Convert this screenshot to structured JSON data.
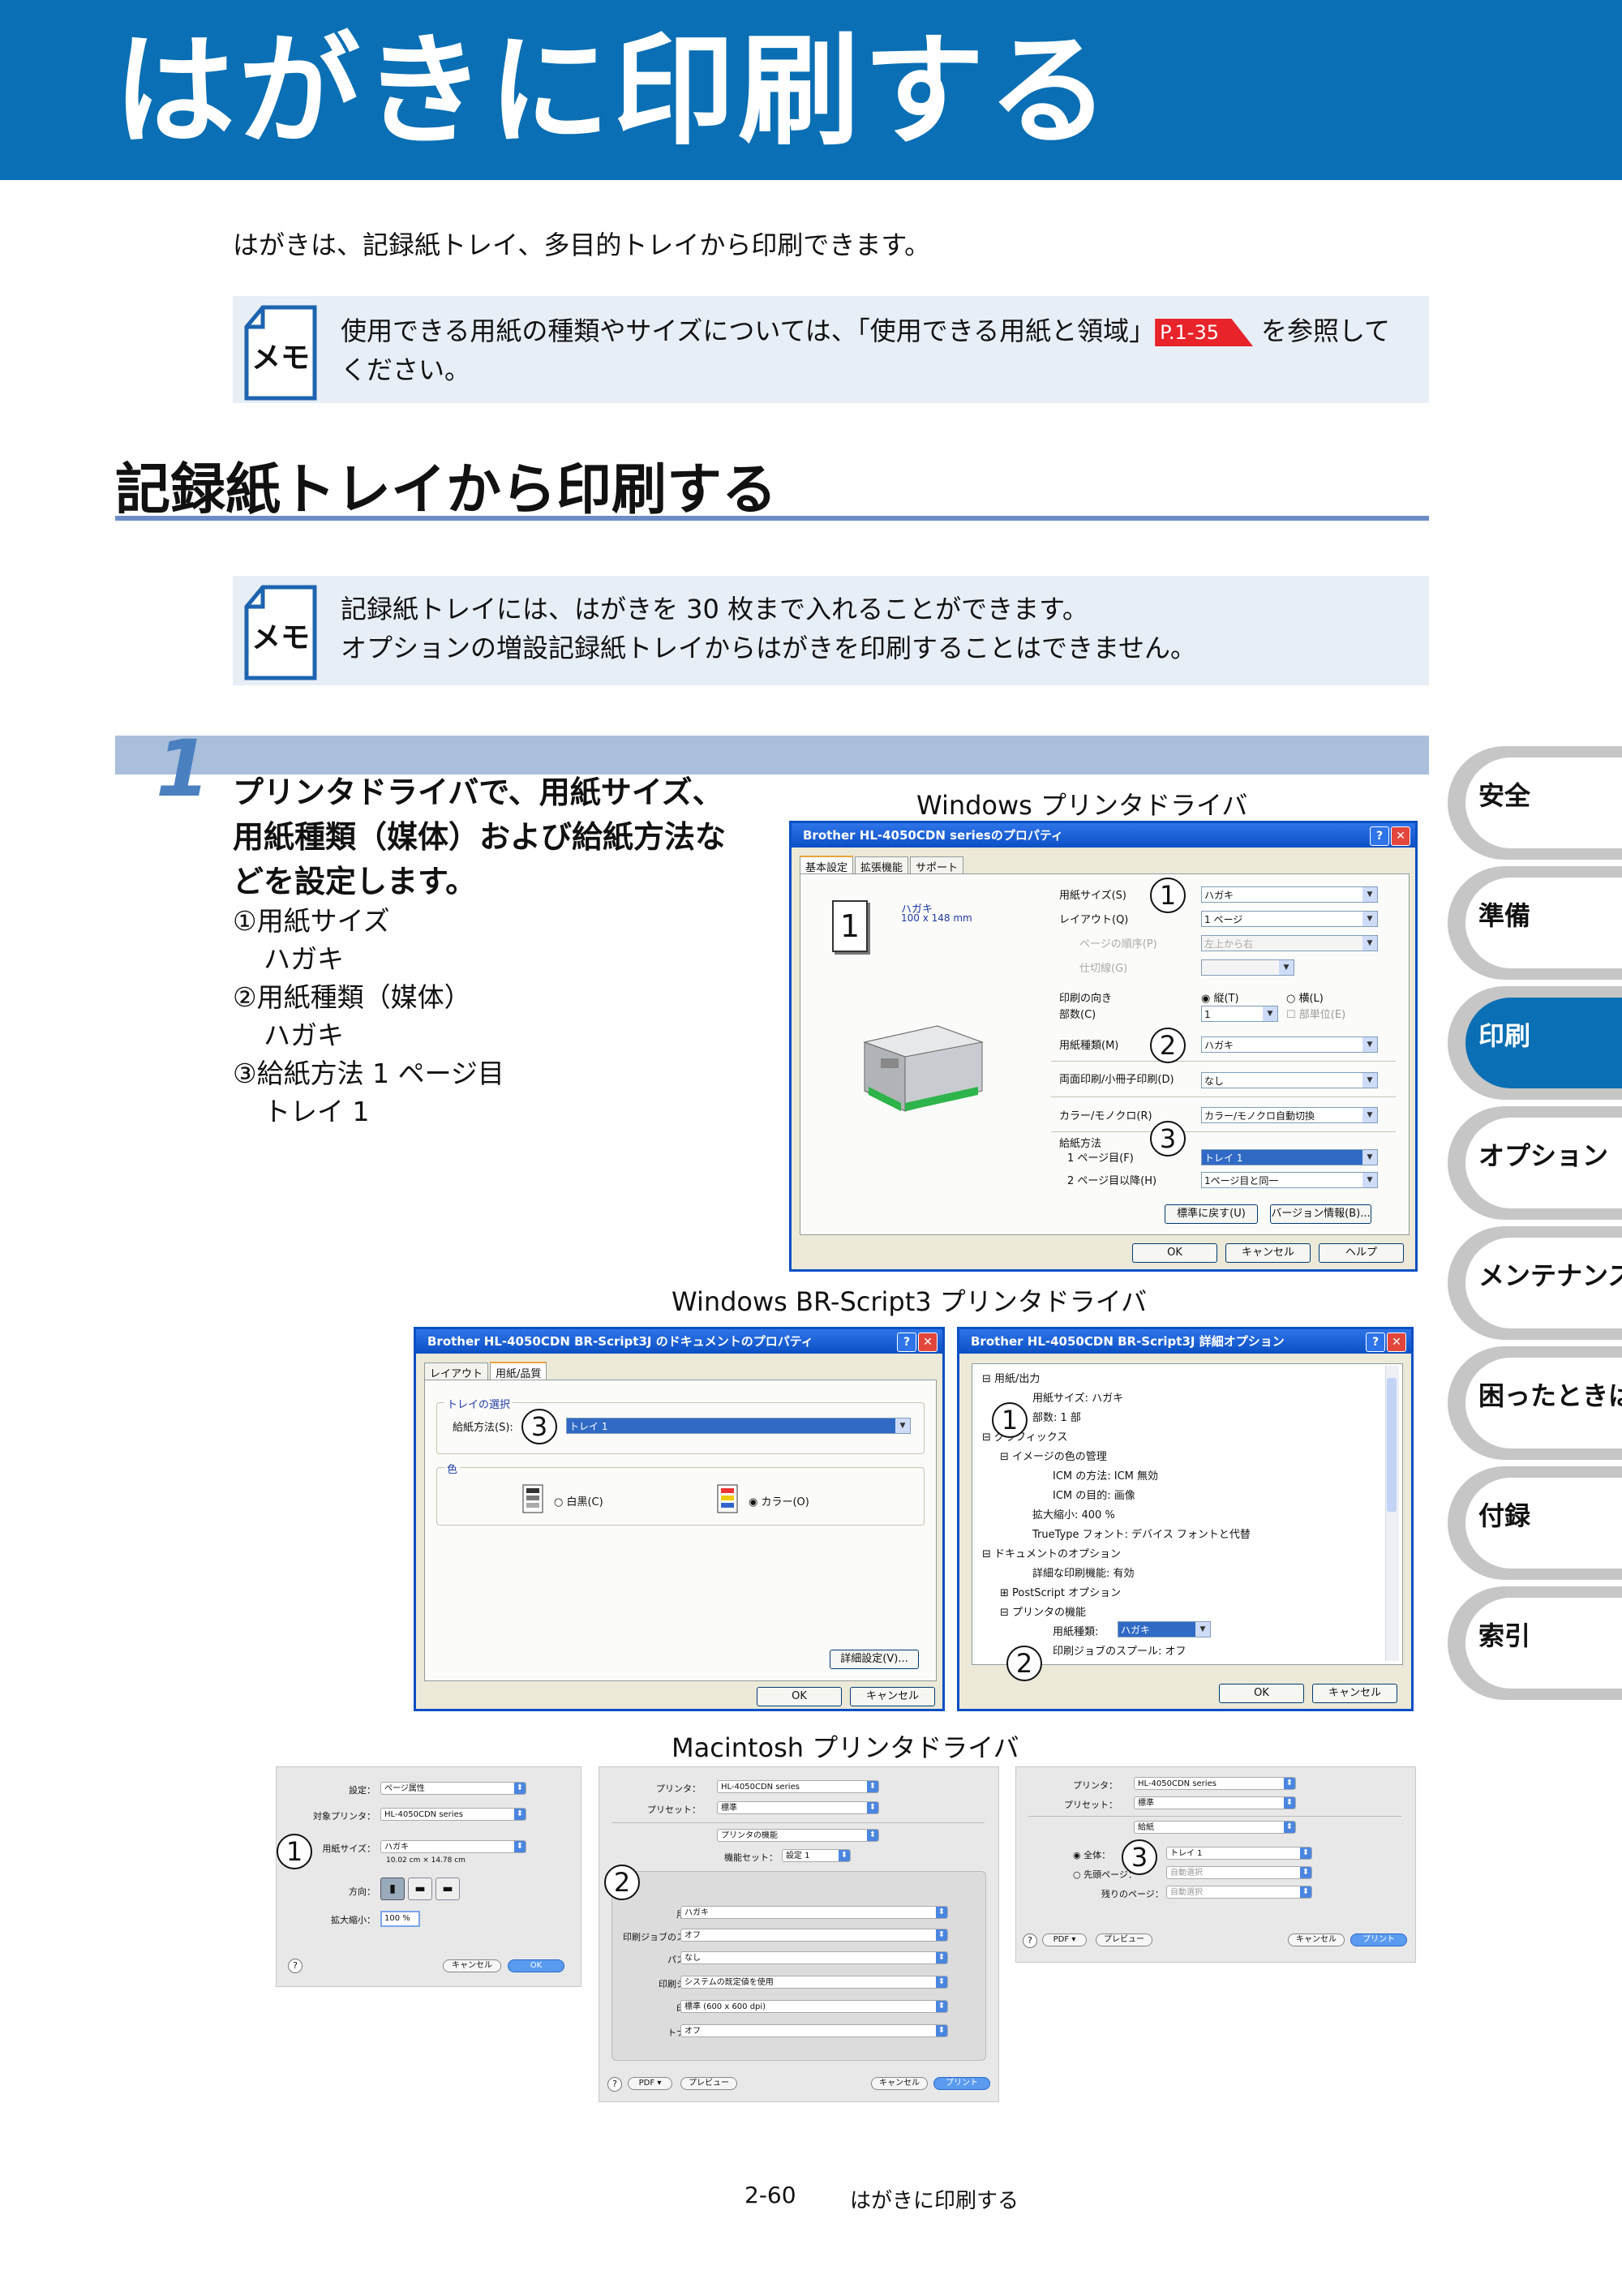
{
  "header": {
    "title": "はがきに印刷する"
  },
  "intro": "はがきは、記録紙トレイ、多目的トレイから印刷できます。",
  "memo1": {
    "icon_label": "メモ",
    "line1_pre": "使用できる用紙の種類やサイズについては、「使用できる用紙と領域」",
    "ref": "P.1-35",
    "line1_post": "を参照して",
    "line2": "ください。"
  },
  "section": {
    "heading": "記録紙トレイから印刷する"
  },
  "memo2": {
    "icon_label": "メモ",
    "line1": "記録紙トレイには、はがきを 30 枚まで入れることができます。",
    "line2": "オプションの増設記録紙トレイからはがきを印刷することはできません。"
  },
  "step": {
    "number": "1",
    "title": "プリンタドライバで、用紙サイズ、用紙種類（媒体）および給紙方法などを設定します。",
    "options": [
      {
        "mark": "①",
        "label": "用紙サイズ",
        "value": "ハガキ"
      },
      {
        "mark": "②",
        "label": "用紙種類（媒体）",
        "value": "ハガキ"
      },
      {
        "mark": "③",
        "label": "給紙方法 1 ページ目",
        "value": "トレイ 1"
      }
    ]
  },
  "captions": {
    "windows": "Windows プリンタドライバ",
    "brscript": "Windows BR-Script3 プリンタドライバ",
    "mac": "Macintosh プリンタドライバ"
  },
  "callouts": {
    "c1": "1",
    "c2": "2",
    "c3": "3"
  },
  "win1": {
    "title": "Brother HL-4050CDN seriesのプロパティ",
    "tabs": [
      "基本設定",
      "拡張機能",
      "サポート"
    ],
    "preview_page": "1",
    "preview_paper": "ハガキ",
    "preview_size": "100 x 148 mm",
    "rows": [
      {
        "label": "用紙サイズ(S)",
        "value": "ハガキ"
      },
      {
        "label": "レイアウト(Q)",
        "value": "1 ページ"
      },
      {
        "label": "ページの順序(P)",
        "value": "左上から右"
      },
      {
        "label": "仕切線(G)",
        "value": ""
      }
    ],
    "orient_label": "印刷の向き",
    "orient_portrait": "縦(T)",
    "orient_landscape": "横(L)",
    "copies_label": "部数(C)",
    "copies_value": "1",
    "collate": "部単位(E)",
    "media_label": "用紙種類(M)",
    "media_value": "ハガキ",
    "duplex_label": "両面印刷/小冊子印刷(D)",
    "duplex_value": "なし",
    "color_label": "カラー/モノクロ(R)",
    "color_value": "カラー/モノクロ自動切換",
    "source_label": "給紙方法",
    "first_label": "1 ページ目(F)",
    "first_value": "トレイ 1",
    "other_label": "2 ページ目以降(H)",
    "other_value": "1ページ目と同一",
    "default_btn": "標準に戻す(U)",
    "version_btn": "バージョン情報(B)...",
    "ok": "OK",
    "cancel": "キャンセル",
    "help": "ヘルプ"
  },
  "win2": {
    "title": "Brother HL-4050CDN BR-Script3J のドキュメントのプロパティ",
    "tabs": [
      "レイアウト",
      "用紙/品質"
    ],
    "tray_group": "トレイの選択",
    "source_label": "給紙方法(S):",
    "source_value": "トレイ 1",
    "color_group": "色",
    "mono": "白黒(C)",
    "color": "カラー(O)",
    "advanced_btn": "詳細設定(V)...",
    "ok": "OK",
    "cancel": "キャンセル"
  },
  "win3": {
    "title": "Brother HL-4050CDN BR-Script3J 詳細オプション",
    "tree": [
      "用紙/出力",
      "用紙サイズ: ハガキ",
      "部数: 1 部",
      "グラフィックス",
      "イメージの色の管理",
      "ICM の方法: ICM 無効",
      "ICM の目的: 画像",
      "拡大縮小: 400 %",
      "TrueType フォント: デバイス フォントと代替",
      "ドキュメントのオプション",
      "詳細な印刷機能: 有効",
      "PostScript オプション",
      "プリンタの機能",
      "用紙種類:",
      "印刷ジョブのスプール: オフ"
    ],
    "media_value": "ハガキ",
    "ok": "OK",
    "cancel": "キャンセル"
  },
  "mac1": {
    "rows": [
      {
        "label": "設定：",
        "value": "ページ属性"
      },
      {
        "label": "対象プリンタ：",
        "value": "HL-4050CDN series"
      },
      {
        "label": "用紙サイズ：",
        "value": "ハガキ"
      }
    ],
    "size_note": "10.02 cm × 14.78 cm",
    "orient_label": "方向：",
    "scale_label": "拡大縮小：",
    "scale_value": "100 %",
    "help": "?",
    "cancel": "キャンセル",
    "ok": "OK"
  },
  "mac2": {
    "printer_label": "プリンタ：",
    "printer_value": "HL-4050CDN series",
    "preset_label": "プリセット：",
    "preset_value": "標準",
    "panel_value": "プリンタの機能",
    "featureset_label": "機能セット：",
    "featureset_value": "設定 1",
    "rows": [
      {
        "label": "用紙媒体：",
        "value": "ハガキ"
      },
      {
        "label": "印刷ジョブのスプール：",
        "value": "オフ"
      },
      {
        "label": "パスワード：",
        "value": "なし"
      },
      {
        "label": "印刷ジョブ名：",
        "value": "システムの既定値を使用"
      },
      {
        "label": "印刷品質：",
        "value": "標準 (600 x 600 dpi)"
      },
      {
        "label": "トナー節約：",
        "value": "オフ"
      }
    ],
    "help": "?",
    "pdf": "PDF ▾",
    "preview": "プレビュー",
    "cancel": "キャンセル",
    "print": "プリント"
  },
  "mac3": {
    "printer_label": "プリンタ：",
    "printer_value": "HL-4050CDN series",
    "preset_label": "プリセット：",
    "preset_value": "標準",
    "panel_value": "給紙",
    "all_label": "全体：",
    "all_value": "トレイ 1",
    "first_label": "先頭ページ：",
    "first_value": "自動選択",
    "rest_label": "残りのページ：",
    "rest_value": "自動選択",
    "help": "?",
    "pdf": "PDF ▾",
    "preview": "プレビュー",
    "cancel": "キャンセル",
    "print": "プリント"
  },
  "sidetabs": [
    "安全",
    "準備",
    "印刷",
    "オプション",
    "メンテナンス",
    "困ったときは",
    "付録",
    "索引"
  ],
  "footer": {
    "page": "2-60",
    "title": "はがきに印刷する"
  },
  "colors": {
    "brand_blue": "#0a6fb4",
    "section_rule": "#6d8cc7",
    "memo_bg": "#e8eef6",
    "ref_red": "#e8232a"
  }
}
